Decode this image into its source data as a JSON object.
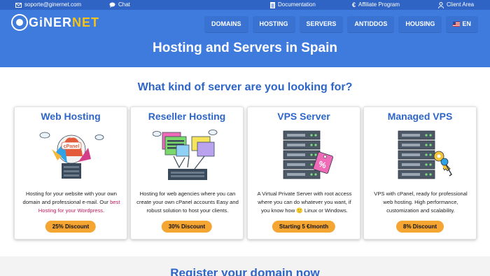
{
  "topbar": {
    "email": "soporte@ginernet.com",
    "chat": "Chat",
    "documentation": "Documentation",
    "affiliate": "Affiliate Program",
    "client_area": "Client Area"
  },
  "logo": {
    "part1": "GiNER",
    "part2": "NET"
  },
  "nav": {
    "items": [
      "DOMAINS",
      "HOSTING",
      "SERVERS",
      "ANTIDDOS",
      "HOUSING"
    ],
    "language": "EN"
  },
  "hero": {
    "title": "Hosting and Servers in Spain"
  },
  "section": {
    "title": "What kind of server are you looking for?"
  },
  "cards": [
    {
      "title": "Web Hosting",
      "desc_1": "Hosting for your website with your own domain and professional e-mail. Our",
      "desc_highlight": "best Hosting for your Wordpress",
      "desc_2": ".",
      "badge": "25% Discount",
      "art_label": "cPanel"
    },
    {
      "title": "Reseller Hosting",
      "desc_1": "Hosting for web agencies where you can create your own cPanel accounts Easy and robust solution to host your clients.",
      "badge": "30% Discount"
    },
    {
      "title": "VPS Server",
      "desc_1": "A Virtual Private Server with root access where you can do whatever you want, if you know how 🙂 Linux or Windows.",
      "badge": "Starting 5 €/month"
    },
    {
      "title": "Managed VPS",
      "desc_1": "VPS with cPanel, ready for professional web hosting. High performance, customization and scalability.",
      "badge": "8% Discount"
    }
  ],
  "footer": {
    "title": "Register your domain now"
  },
  "colors": {
    "brand_blue": "#3f7bdd",
    "accent_yellow": "#f5c21a",
    "badge_orange": "#f5a531",
    "link_blue": "#2e66c8",
    "highlight": "#c2185b"
  }
}
